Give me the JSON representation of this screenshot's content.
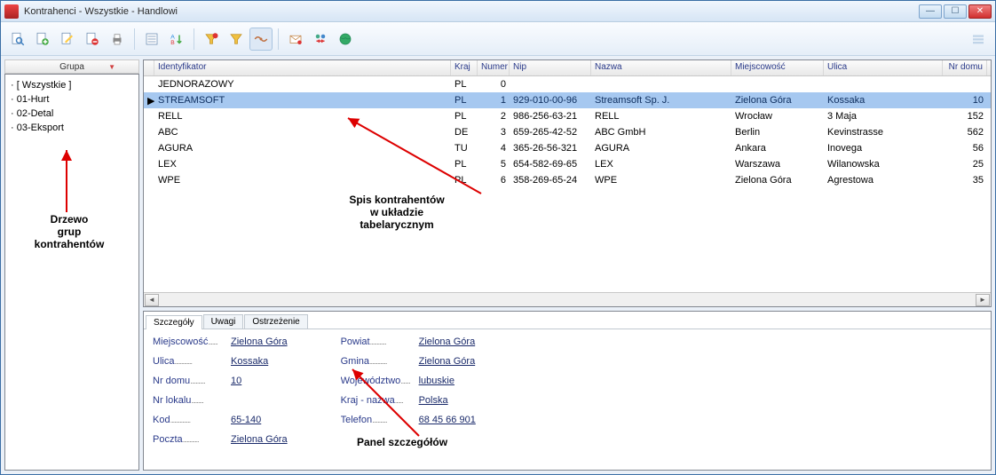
{
  "window": {
    "title": "Kontrahenci - Wszystkie - Handlowi"
  },
  "toolbar_icons": [
    "search",
    "doc-new",
    "doc-edit",
    "doc-delete",
    "print",
    "sep",
    "calculator",
    "sort-az",
    "sep",
    "funnel-add",
    "funnel-remove",
    "handshake",
    "sep",
    "mail",
    "swap-people",
    "globe"
  ],
  "grupa_header": "Grupa",
  "tree": {
    "items": [
      "[ Wszystkie ]",
      "01-Hurt",
      "02-Detal",
      "03-Eksport"
    ]
  },
  "grid": {
    "columns": [
      "Identyfikator",
      "Kraj",
      "Numer",
      "Nip",
      "Nazwa",
      "Miejscowość",
      "Ulica",
      "Nr domu"
    ],
    "rows": [
      {
        "sel": false,
        "id": "JEDNORAZOWY",
        "kraj": "PL",
        "num": "0",
        "nip": "",
        "nazwa": "",
        "miej": "",
        "ul": "",
        "nrd": ""
      },
      {
        "sel": true,
        "id": "STREAMSOFT",
        "kraj": "PL",
        "num": "1",
        "nip": "929-010-00-96",
        "nazwa": "Streamsoft Sp. J.",
        "miej": "Zielona Góra",
        "ul": "Kossaka",
        "nrd": "10"
      },
      {
        "sel": false,
        "id": "RELL",
        "kraj": "PL",
        "num": "2",
        "nip": "986-256-63-21",
        "nazwa": "RELL",
        "miej": "Wrocław",
        "ul": "3 Maja",
        "nrd": "152"
      },
      {
        "sel": false,
        "id": "ABC",
        "kraj": "DE",
        "num": "3",
        "nip": "659-265-42-52",
        "nazwa": "ABC GmbH",
        "miej": "Berlin",
        "ul": "Kevinstrasse",
        "nrd": "562"
      },
      {
        "sel": false,
        "id": "AGURA",
        "kraj": "TU",
        "num": "4",
        "nip": "365-26-56-321",
        "nazwa": "AGURA",
        "miej": "Ankara",
        "ul": "Inovega",
        "nrd": "56"
      },
      {
        "sel": false,
        "id": "LEX",
        "kraj": "PL",
        "num": "5",
        "nip": "654-582-69-65",
        "nazwa": "LEX",
        "miej": "Warszawa",
        "ul": "Wilanowska",
        "nrd": "25"
      },
      {
        "sel": false,
        "id": "WPE",
        "kraj": "PL",
        "num": "6",
        "nip": "358-269-65-24",
        "nazwa": "WPE",
        "miej": "Zielona Góra",
        "ul": "Agrestowa",
        "nrd": "35"
      }
    ]
  },
  "tabs": {
    "items": [
      "Szczegóły",
      "Uwagi",
      "Ostrzeżenie"
    ],
    "active": 0
  },
  "details": {
    "left": [
      {
        "label": "Miejscowość",
        "value": "Zielona Góra"
      },
      {
        "label": "Ulica",
        "value": "Kossaka"
      },
      {
        "label": "Nr domu",
        "value": "10"
      },
      {
        "label": "Nr lokalu",
        "value": ""
      },
      {
        "label": "Kod",
        "value": "65-140"
      },
      {
        "label": "Poczta",
        "value": "Zielona Góra"
      }
    ],
    "right": [
      {
        "label": "Powiat",
        "value": "Zielona Góra"
      },
      {
        "label": "Gmina",
        "value": "Zielona Góra"
      },
      {
        "label": "Województwo",
        "value": "lubuskie"
      },
      {
        "label": "Kraj - nazwa",
        "value": "Polska"
      },
      {
        "label": "Telefon",
        "value": "68 45 66 901"
      }
    ]
  },
  "annotations": {
    "tree_label": "Drzewo\ngrup\nkontrahentów",
    "grid_label": "Spis kontrahentów\nw układzie\ntabelarycznym",
    "detail_label": "Panel szczegółów"
  }
}
